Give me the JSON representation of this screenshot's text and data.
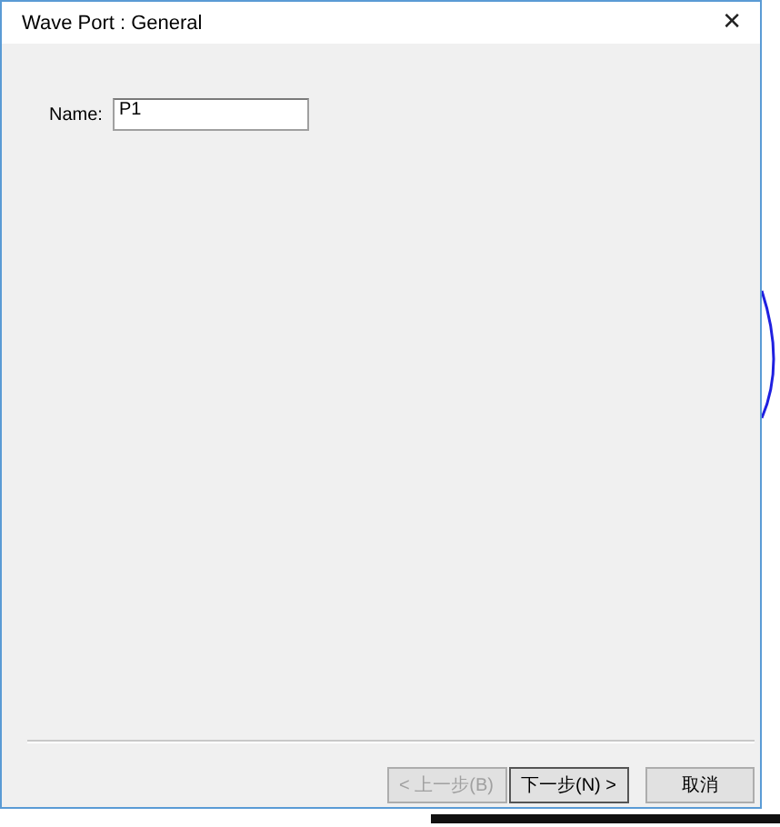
{
  "window": {
    "title": "Wave Port : General",
    "close": "✕"
  },
  "fields": [
    {
      "label": "Name:",
      "value": "P1"
    }
  ],
  "buttons": [
    {
      "label": "< 上一步(B)",
      "disabled": true
    },
    {
      "label": "下一步(N) >",
      "disabled": false,
      "default": true
    },
    {
      "label": "取消",
      "disabled": false,
      "default": false
    }
  ]
}
